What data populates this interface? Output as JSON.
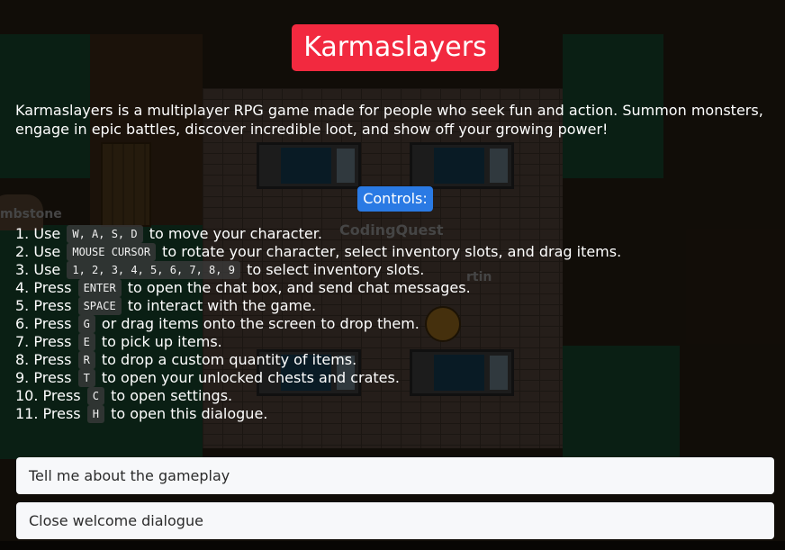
{
  "game": {
    "title": "Karmaslayers",
    "intro": "Karmaslayers is a multiplayer RPG game made for people who seek fun and action. Summon monsters, engage in epic battles, discover incredible loot, and show off your growing power!",
    "controls_heading": "Controls:",
    "controls": [
      {
        "prefix": "1. Use",
        "keys": [
          "W, A, S, D"
        ],
        "suffix": "to move your character."
      },
      {
        "prefix": "2. Use",
        "keys": [
          "MOUSE CURSOR"
        ],
        "suffix": "to rotate your character, select inventory slots, and drag items."
      },
      {
        "prefix": "3. Use",
        "keys": [
          "1, 2, 3, 4, 5, 6, 7, 8, 9"
        ],
        "suffix": "to select inventory slots."
      },
      {
        "prefix": "4. Press",
        "keys": [
          "ENTER"
        ],
        "suffix": "to open the chat box, and send chat messages."
      },
      {
        "prefix": "5. Press",
        "keys": [
          "SPACE"
        ],
        "suffix": "to interact with the game."
      },
      {
        "prefix": "6. Press",
        "keys": [
          "G"
        ],
        "suffix": "or drag items onto the screen to drop them."
      },
      {
        "prefix": "7. Press",
        "keys": [
          "E"
        ],
        "suffix": "to pick up items."
      },
      {
        "prefix": "8. Press",
        "keys": [
          "R"
        ],
        "suffix": "to drop a custom quantity of items."
      },
      {
        "prefix": "9. Press",
        "keys": [
          "T"
        ],
        "suffix": "to open your unlocked chests and crates."
      },
      {
        "prefix": "10. Press",
        "keys": [
          "C"
        ],
        "suffix": "to open settings."
      },
      {
        "prefix": "11. Press",
        "keys": [
          "H"
        ],
        "suffix": "to open this dialogue."
      }
    ],
    "buttons": {
      "gameplay": "Tell me about the gameplay",
      "close": "Close welcome dialogue"
    }
  },
  "scene": {
    "labels": {
      "player_name": "CodingQuest",
      "tombstone": "mbstone",
      "other_player": "rtin"
    }
  },
  "colors": {
    "title_bg": "#f2293f",
    "controls_bg": "#2a7ae4",
    "button_bg": "#f7f8fa"
  }
}
